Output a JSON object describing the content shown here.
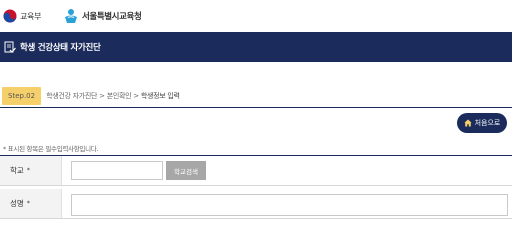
{
  "header": {
    "ministry_logo": "교육부",
    "office_logo": "서울특별시교육청"
  },
  "title_bar": {
    "icon": "document-check-icon",
    "title": "학생 건강상태 자가진단"
  },
  "step": {
    "badge": "Step.02",
    "breadcrumb": [
      {
        "label": "학생건강 자가진단"
      },
      {
        "label": "본인확인"
      },
      {
        "label": "학생정보 입력"
      }
    ],
    "separator": ">"
  },
  "home_button": {
    "label": "처음으로",
    "icon": "home-icon"
  },
  "required_note": "* 표시된 항목은 필수입력사항입니다.",
  "form": {
    "school": {
      "label": "학교",
      "required_mark": "*",
      "value": "",
      "button_label": "학교검색"
    },
    "name": {
      "label": "성명",
      "required_mark": "*",
      "value": ""
    }
  },
  "colors": {
    "navy": "#1b2c5c",
    "step_badge": "#f5cf6a",
    "search_button": "#a7a7a7",
    "label_bg": "#f3f3f3"
  }
}
